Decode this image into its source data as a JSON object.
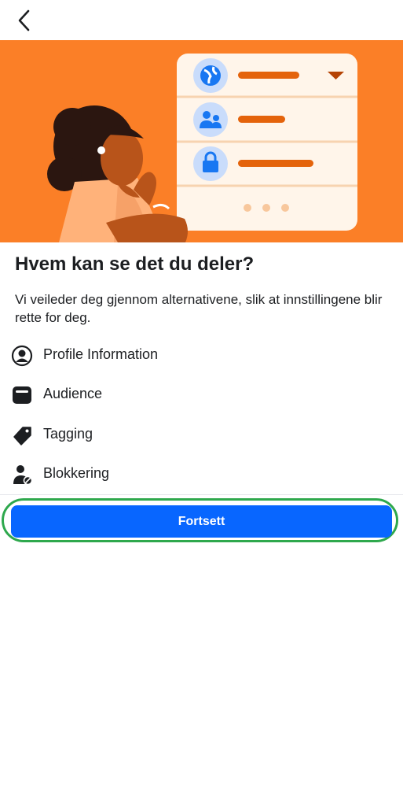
{
  "header": {
    "back_icon": "chevron-left-icon"
  },
  "colors": {
    "hero_bg": "#fb7f27",
    "primary": "#0866ff",
    "focus_ring": "#2ea84d"
  },
  "content": {
    "title": "Hvem kan se det du deler?",
    "description": "Vi veileder deg gjennom alternativene, slik at innstillingene blir rette for deg.",
    "items": [
      {
        "label": "Profile Information",
        "icon": "user-circle-icon"
      },
      {
        "label": "Audience",
        "icon": "browser-window-icon"
      },
      {
        "label": "Tagging",
        "icon": "tag-icon"
      },
      {
        "label": "Blokkering",
        "icon": "user-blocked-icon"
      }
    ]
  },
  "cta": {
    "label": "Fortsett"
  }
}
